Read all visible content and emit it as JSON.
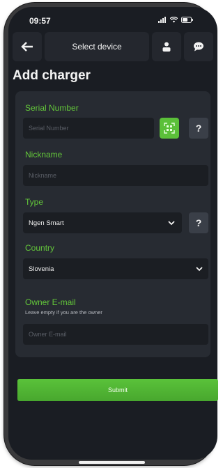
{
  "status_bar": {
    "time": "09:57"
  },
  "header": {
    "title": "Select device"
  },
  "page_title": "Add charger",
  "form": {
    "serial": {
      "label": "Serial Number",
      "placeholder": "Serial Number",
      "help": "?"
    },
    "nickname": {
      "label": "Nickname",
      "placeholder": "Nickname"
    },
    "type": {
      "label": "Type",
      "value": "Ngen Smart",
      "help": "?"
    },
    "country": {
      "label": "Country",
      "value": "Slovenia"
    },
    "owner_email": {
      "label": "Owner E-mail",
      "hint": "Leave empty if you are the owner",
      "placeholder": "Owner E-mail"
    }
  },
  "actions": {
    "submit": "Submit"
  },
  "colors": {
    "accent": "#5bc039",
    "background": "#1a1d23",
    "panel": "#272b32"
  }
}
